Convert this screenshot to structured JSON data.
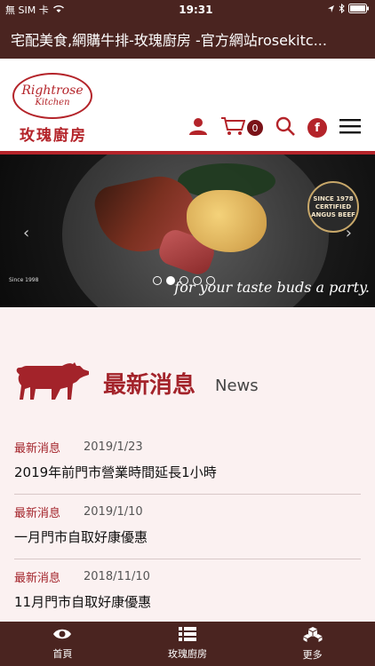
{
  "status": {
    "carrier": "無 SIM 卡",
    "time": "19:31"
  },
  "titlebar": {
    "title": "宅配美食,網購牛排-玫瑰廚房 -官方網站rosekitc..."
  },
  "logo": {
    "script_text": "Rightrose",
    "kitchen_text": "Kitchen",
    "name": "玫瑰廚房"
  },
  "header": {
    "cart_count": "0",
    "fb_label": "f"
  },
  "hero": {
    "tagline": "for your taste buds a party.",
    "badge_since": "SINCE 1978",
    "badge_line1": "CERTIFIED",
    "badge_line2": "ANGUS BEEF",
    "since_small": "Since 1998",
    "active_slide": 1,
    "slide_count": 5
  },
  "news": {
    "title": "最新消息",
    "title_en": "News",
    "items": [
      {
        "category": "最新消息",
        "date": "2019/1/23",
        "text": "2019年前門市營業時間延長1小時"
      },
      {
        "category": "最新消息",
        "date": "2019/1/10",
        "text": "一月門市自取好康優惠"
      },
      {
        "category": "最新消息",
        "date": "2018/11/10",
        "text": "11月門市自取好康優惠"
      }
    ]
  },
  "tabbar": {
    "tabs": [
      {
        "label": "首頁"
      },
      {
        "label": "玫瑰廚房"
      },
      {
        "label": "更多"
      }
    ]
  },
  "colors": {
    "brand_red": "#b4242a",
    "bar_brown": "#4a2420",
    "background": "#fbf1f1"
  }
}
